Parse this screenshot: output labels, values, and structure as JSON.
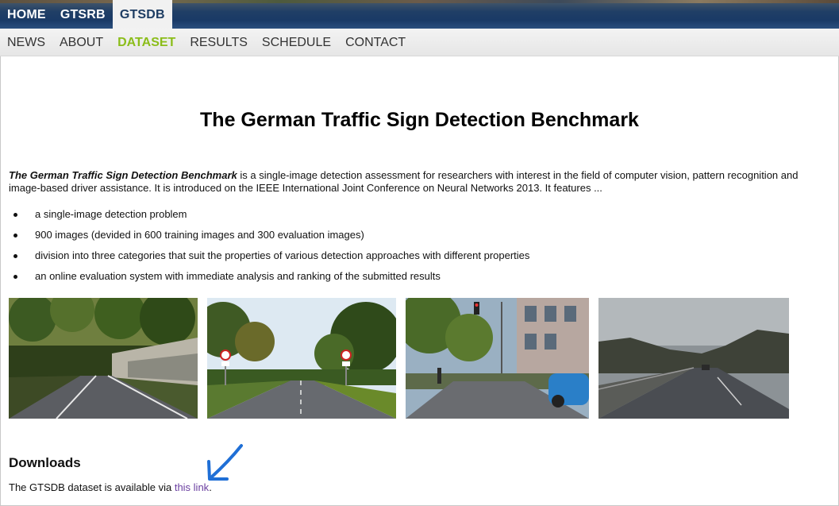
{
  "top_nav": {
    "items": [
      {
        "label": "HOME",
        "active": false
      },
      {
        "label": "GTSRB",
        "active": false
      },
      {
        "label": "GTSDB",
        "active": true
      }
    ]
  },
  "sub_nav": {
    "items": [
      {
        "label": "NEWS",
        "active": false
      },
      {
        "label": "ABOUT",
        "active": false
      },
      {
        "label": "DATASET",
        "active": true
      },
      {
        "label": "RESULTS",
        "active": false
      },
      {
        "label": "SCHEDULE",
        "active": false
      },
      {
        "label": "CONTACT",
        "active": false
      }
    ],
    "active_color": "#8bbd1a"
  },
  "page": {
    "title": "The German Traffic Sign Detection Benchmark",
    "intro_emphasis": "The German Traffic Sign Detection Benchmark",
    "intro_rest": " is a single-image detection assessment for researchers with interest in the field of computer vision, pattern recognition and image-based driver assistance. It is introduced on the IEEE International Joint Conference on Neural Networks 2013. It features ...",
    "features": [
      "a single-image detection problem",
      "900 images (devided in 600 training images and 300 evaluation images)",
      "division into three categories that suit the properties of various detection approaches with different properties",
      "an online evaluation system with immediate analysis and ranking of the submitted results"
    ],
    "photos": [
      {
        "icon": "forest-road-photo"
      },
      {
        "icon": "rural-road-signs-photo"
      },
      {
        "icon": "city-street-photo"
      },
      {
        "icon": "foggy-highway-photo"
      }
    ]
  },
  "downloads": {
    "heading": "Downloads",
    "text_before": "The GTSDB dataset is available via ",
    "link_label": "this link",
    "text_after": ".",
    "link_color": "#6a3fa0",
    "annotation_arrow_color": "#1f6fd6"
  }
}
